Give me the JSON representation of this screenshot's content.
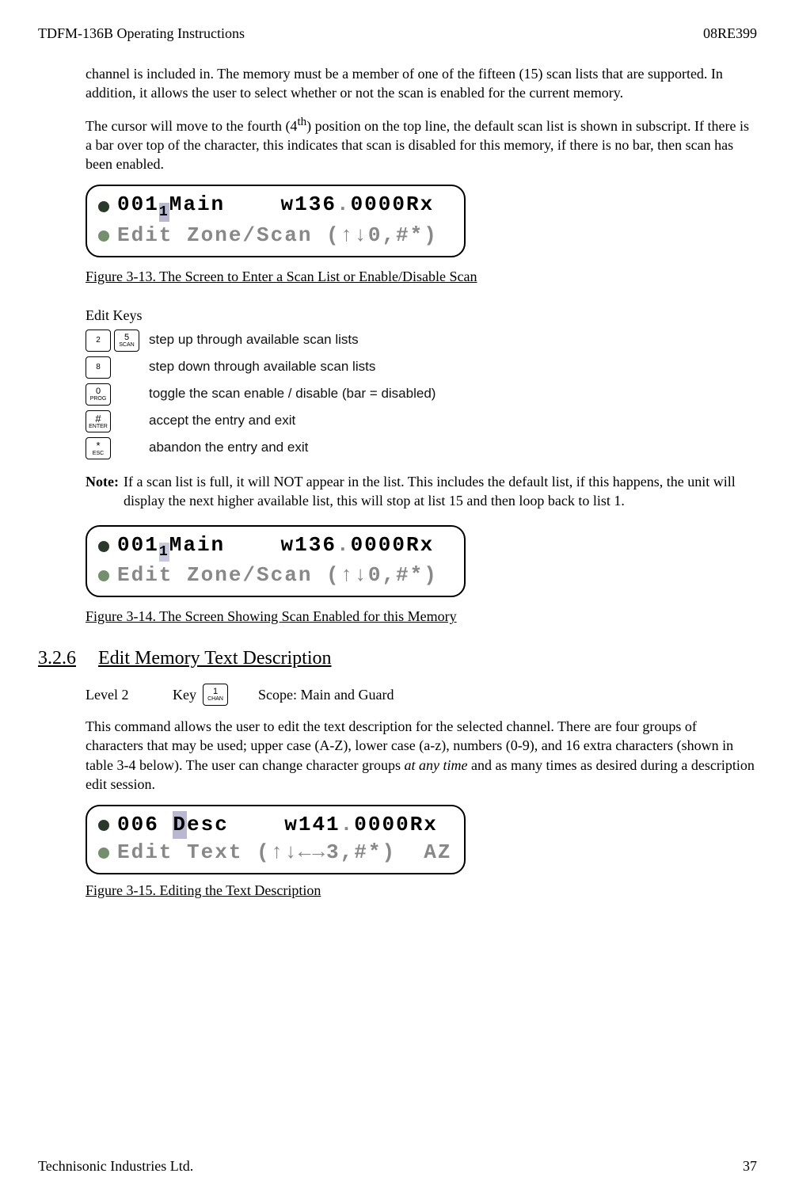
{
  "header": {
    "left": "TDFM-136B Operating Instructions",
    "right": "08RE399"
  },
  "para1": "channel is included in. The memory must be a member of one of the fifteen (15) scan lists that are supported. In addition, it allows the user to select whether or not the scan is enabled for the current memory.",
  "para2_a": "The cursor will move to the fourth (4",
  "para2_sup": "th",
  "para2_b": ") position on the top line, the default scan list is shown in subscript. If there is a bar over top of the character, this indicates that scan is disabled for this memory, if there is no bar, then scan has been enabled.",
  "lcd1": {
    "row1_a": "001",
    "row1_cursor": "1",
    "row1_b": "Main    w136",
    "row1_dot": ".",
    "row1_c": "0000Rx",
    "row2": "Edit Zone/Scan (↑↓0,#*)"
  },
  "fig13": "Figure 3-13. The Screen to Enter a Scan List or Enable/Disable Scan",
  "edit_keys_label": "Edit Keys",
  "keys": [
    {
      "k1_top": "2",
      "k1_sub": "",
      "k2_top": "5",
      "k2_sub": "SCAN",
      "desc": "step up through available scan lists"
    },
    {
      "k1_top": "8",
      "k1_sub": "",
      "desc": "step down through available scan lists"
    },
    {
      "k1_top": "0",
      "k1_sub": "PROG",
      "desc": "toggle the scan enable / disable (bar = disabled)"
    },
    {
      "k1_top": "#",
      "k1_sub": "ENTER",
      "desc": "accept the entry and exit"
    },
    {
      "k1_top": "*",
      "k1_sub": "ESC",
      "desc": "abandon the entry and exit"
    }
  ],
  "note_label": "Note:",
  "note_text": "If a scan list is full, it will NOT appear in the list. This includes the default list, if this happens, the unit will display the next higher available list, this will stop at list 15 and then loop back to list 1.",
  "lcd2": {
    "row1_a": "001",
    "row1_cursor": "1",
    "row1_b": "Main    w136",
    "row1_dot": ".",
    "row1_c": "0000Rx",
    "row2": "Edit Zone/Scan (↑↓0,#*)"
  },
  "fig14": "Figure 3-14. The Screen Showing Scan Enabled for this Memory",
  "section": {
    "num": "3.2.6",
    "title": "Edit Memory Text Description"
  },
  "level": {
    "label": "Level 2",
    "key_label": "Key",
    "key_top": "1",
    "key_sub": "CHAN",
    "scope": "Scope: Main and Guard"
  },
  "para3_a": "This command allows the user to edit the text description for the selected channel. There are four groups of characters that may be used; upper case (A-Z), lower case (a-z), numbers (0-9), and 16 extra characters (shown in table 3-4 below). The user can change character groups ",
  "para3_i": "at any time",
  "para3_b": " and as many times as desired during a description edit session.",
  "lcd3": {
    "row1_a": "006 ",
    "row1_cursor": "D",
    "row1_b": "esc    w141",
    "row1_dot": ".",
    "row1_c": "0000Rx",
    "row2": "Edit Text (↑↓←→3,#*)  AZ"
  },
  "fig15": "Figure 3-15. Editing the Text Description",
  "footer": {
    "left": "Technisonic Industries Ltd.",
    "right": "37"
  }
}
